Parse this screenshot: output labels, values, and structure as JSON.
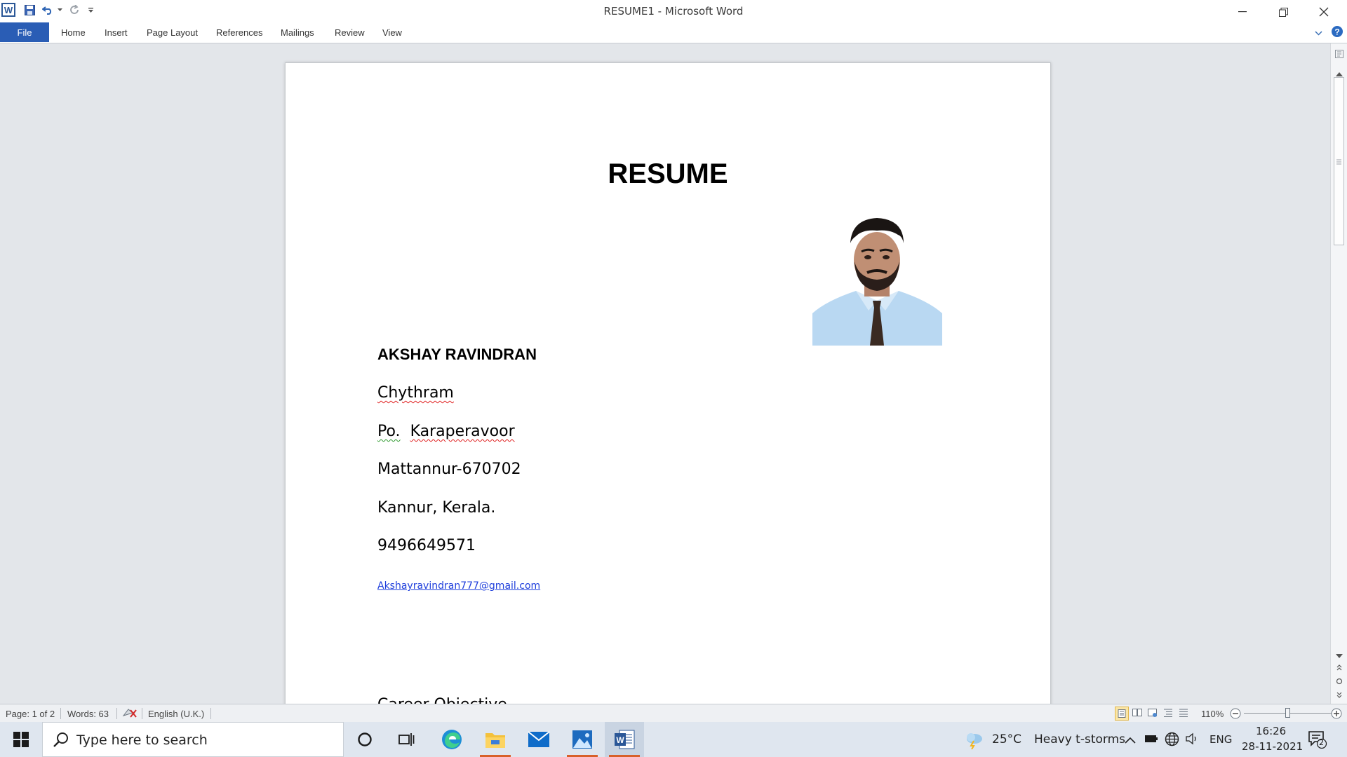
{
  "window": {
    "title": "RESUME1  -  Microsoft Word",
    "app_icon": "word-icon"
  },
  "quick_access": {
    "icons": [
      "save-icon",
      "undo-icon",
      "redo-icon",
      "customize-icon"
    ]
  },
  "ribbon": {
    "file_label": "File",
    "tabs": [
      "Home",
      "Insert",
      "Page Layout",
      "References",
      "Mailings",
      "Review",
      "View"
    ]
  },
  "document": {
    "heading": "RESUME",
    "name": "AKSHAY RAVINDRAN",
    "address_line1": "Chythram",
    "po_prefix": "Po.",
    "po_place": "Karaperavoor",
    "address_line3": "Mattannur-670702",
    "address_line4": "Kannur, Kerala.",
    "phone": "9496649571",
    "email": "Akshayravindran777@gmail.com",
    "next_heading": "Career Objective"
  },
  "status_bar": {
    "page": "Page: 1 of 2",
    "words": "Words: 63",
    "language": "English (U.K.)",
    "zoom": "110%"
  },
  "taskbar": {
    "search_placeholder": "Type here to search",
    "weather_temp": "25°C",
    "weather_text": "Heavy t-storms",
    "language": "ENG",
    "time": "16:26",
    "date": "28-11-2021",
    "notification_count": "2"
  },
  "colors": {
    "file_tab": "#2a5db5",
    "link": "#1f3fdc",
    "accent_running": "#d8602a"
  }
}
